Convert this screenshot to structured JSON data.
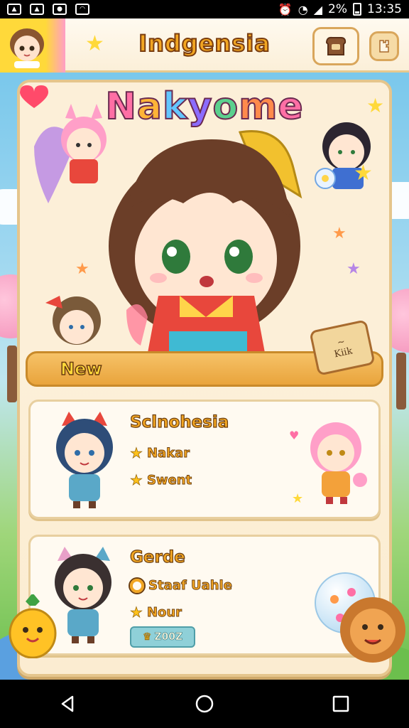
{
  "status_bar": {
    "battery": "2%",
    "time": "13:35",
    "icons": [
      "gallery-icon",
      "image-icon",
      "map-pin-icon",
      "app-icon",
      "alarm-icon",
      "wifi-icon",
      "signal-icon",
      "battery-icon"
    ]
  },
  "header": {
    "title": "Indgensia",
    "buttons": [
      "toast-menu-icon",
      "puzzle-icon"
    ]
  },
  "hero": {
    "title_letters": [
      "N",
      "a",
      "k",
      "y",
      "o",
      "m",
      "e",
      ""
    ],
    "new_label": "New",
    "toast_text_1": "~",
    "toast_text_2": "Kiik"
  },
  "cards": [
    {
      "title": "Sclnohesia",
      "rows": [
        {
          "icon": "star-icon",
          "text": "Nakar"
        },
        {
          "icon": "star-icon",
          "text": "Swent"
        }
      ]
    },
    {
      "title": "Gerde",
      "rows": [
        {
          "icon": "ring-icon",
          "text": "Staaf Uahle"
        },
        {
          "icon": "star-icon",
          "text": "Nour"
        }
      ],
      "chip": "Z00Z"
    }
  ],
  "nav": [
    "back-icon",
    "home-icon",
    "recents-icon"
  ],
  "colors": {
    "accent": "#f2a622",
    "outline": "#6a3d10",
    "panel": "#fdf3df",
    "sky": "#6fc3ea"
  }
}
